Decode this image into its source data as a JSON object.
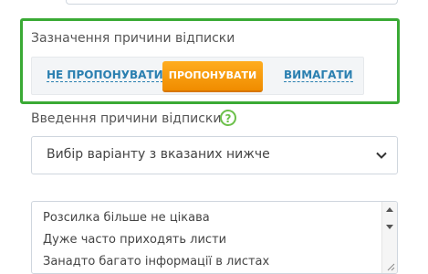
{
  "unsubscribe_reason": {
    "label": "Зазначення причини відписки",
    "options": [
      {
        "label": "НЕ ПРОПОНУВАТИ"
      },
      {
        "label": "ПРОПОНУВАТИ",
        "selected": true
      },
      {
        "label": "ВИМАГАТИ"
      }
    ]
  },
  "reason_input": {
    "label": "Введення причини відписки",
    "help_symbol": "?",
    "select_value": "Вибір варіанту з вказаних нижче",
    "textarea_lines": [
      "Розсилка більше не цікава",
      "Дуже часто приходять листи",
      "Занадто багато інформації в листах"
    ]
  },
  "colors": {
    "highlight_border": "#3aaa35",
    "link": "#2a7fb0",
    "active_button": "#f5a000",
    "help": "#6cc04a"
  }
}
